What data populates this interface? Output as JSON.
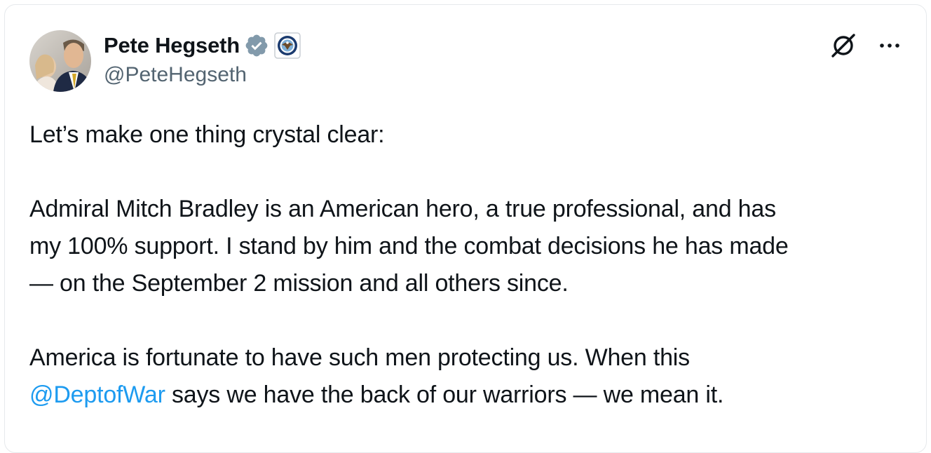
{
  "author": {
    "display_name": "Pete Hegseth",
    "handle": "@PeteHegseth",
    "verified": true,
    "verified_color": "#829aab",
    "affiliate_badge": "department-seal-icon"
  },
  "actions": {
    "grok_icon": "grok-icon",
    "more_icon": "more-icon"
  },
  "tweet": {
    "para1": "Let’s make one thing crystal clear:",
    "para2_line1": "Admiral Mitch Bradley is an American hero, a true professional, and has",
    "para2_line2": "my 100% support. I stand by him and the combat decisions he has made",
    "para2_line3": "— on the September 2 mission and all others since.",
    "para3_line1": "America is fortunate to have such men protecting us. When this",
    "para3_mention": "@DeptofWar",
    "para3_line2_rest": " says we have the back of our warriors — we mean it."
  },
  "colors": {
    "text": "#0f1419",
    "secondary": "#536471",
    "link": "#1d9bf0"
  }
}
